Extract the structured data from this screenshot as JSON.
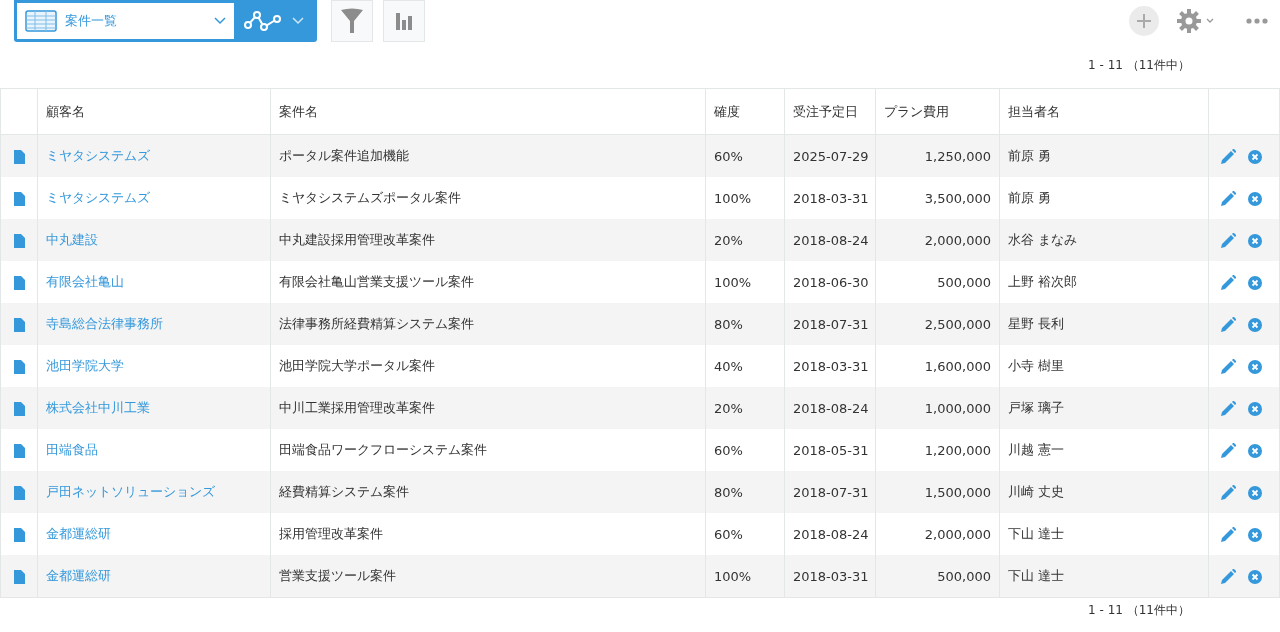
{
  "view_selector": {
    "label": "案件一覧"
  },
  "pager_top": "1 - 11 （11件中）",
  "table": {
    "columns": [
      "顧客名",
      "案件名",
      "確度",
      "受注予定日",
      "プラン費用",
      "担当者名"
    ],
    "rows": [
      {
        "customer": "ミヤタシステムズ",
        "project": "ポータル案件追加機能",
        "probability": "60%",
        "date": "2025-07-29",
        "amount": "1,250,000",
        "owner": "前原 勇"
      },
      {
        "customer": "ミヤタシステムズ",
        "project": "ミヤタシステムズポータル案件",
        "probability": "100%",
        "date": "2018-03-31",
        "amount": "3,500,000",
        "owner": "前原 勇"
      },
      {
        "customer": "中丸建設",
        "project": "中丸建設採用管理改革案件",
        "probability": "20%",
        "date": "2018-08-24",
        "amount": "2,000,000",
        "owner": "水谷 まなみ"
      },
      {
        "customer": "有限会社亀山",
        "project": "有限会社亀山営業支援ツール案件",
        "probability": "100%",
        "date": "2018-06-30",
        "amount": "500,000",
        "owner": "上野 裕次郎"
      },
      {
        "customer": "寺島総合法律事務所",
        "project": "法律事務所経費精算システム案件",
        "probability": "80%",
        "date": "2018-07-31",
        "amount": "2,500,000",
        "owner": "星野 長利"
      },
      {
        "customer": "池田学院大学",
        "project": "池田学院大学ポータル案件",
        "probability": "40%",
        "date": "2018-03-31",
        "amount": "1,600,000",
        "owner": "小寺 樹里"
      },
      {
        "customer": "株式会社中川工業",
        "project": "中川工業採用管理改革案件",
        "probability": "20%",
        "date": "2018-08-24",
        "amount": "1,000,000",
        "owner": "戸塚 璃子"
      },
      {
        "customer": "田端食品",
        "project": "田端食品ワークフローシステム案件",
        "probability": "60%",
        "date": "2018-05-31",
        "amount": "1,200,000",
        "owner": "川越 憲一"
      },
      {
        "customer": "戸田ネットソリューションズ",
        "project": "経費精算システム案件",
        "probability": "80%",
        "date": "2018-07-31",
        "amount": "1,500,000",
        "owner": "川崎 丈史"
      },
      {
        "customer": "金都運総研",
        "project": "採用管理改革案件",
        "probability": "60%",
        "date": "2018-08-24",
        "amount": "2,000,000",
        "owner": "下山 達士"
      },
      {
        "customer": "金都運総研",
        "project": "営業支援ツール案件",
        "probability": "100%",
        "date": "2018-03-31",
        "amount": "500,000",
        "owner": "下山 達士"
      }
    ]
  },
  "pager_bottom": "1 - 11 （11件中）"
}
